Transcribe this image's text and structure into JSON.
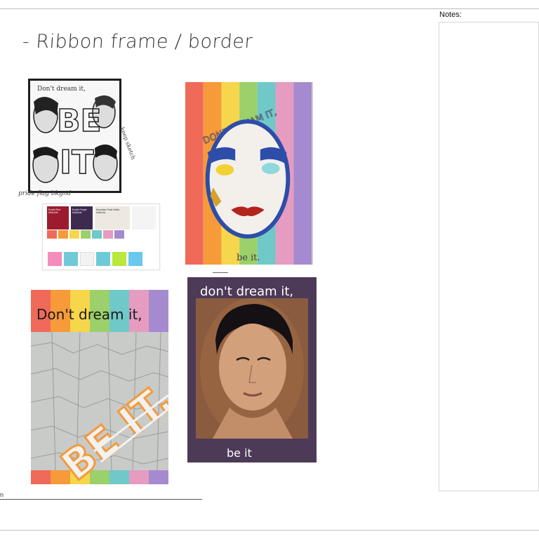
{
  "notes": {
    "label": "Notes:"
  },
  "heading": "- Ribbon frame / border",
  "sketch": {
    "line1": "Don't dream it,",
    "big1": "BE",
    "big2": "IT",
    "side_note": "keep sketch",
    "caption": "pride flag bkgnd"
  },
  "palette": {
    "swatches": [
      {
        "name": "Exotic Red",
        "code": "#9d1b2e",
        "color": "#9d1b2e"
      },
      {
        "name": "Exotic Purple",
        "code": "#3d2a4e",
        "color": "#3d2a4e"
      },
      {
        "name": "Mountain Peak White",
        "code": "#e8e4dc",
        "color": "#ede9e1"
      }
    ],
    "small_colors": [
      "#ef6a58",
      "#f69a3a",
      "#f6d64a",
      "#9bd06a",
      "#6fc9c8",
      "#e69bc0",
      "#a68ad0"
    ],
    "note_colors": [
      "#f48cbc",
      "#6fcad8",
      "#f2f2f2",
      "#7ee07a",
      "#b8e83a",
      "#6ac7ee"
    ]
  },
  "mask_poster": {
    "stripes": [
      "#ef6a58",
      "#f69a3a",
      "#f6d64a",
      "#9bd06a",
      "#6fc9c8",
      "#e69bc0",
      "#a68ad0"
    ],
    "top_text": "DON'T DREAM IT,",
    "bottom_text": "be it."
  },
  "cracked_poster": {
    "stripes": [
      "#ef6a58",
      "#f69a3a",
      "#f6d64a",
      "#9bd06a",
      "#6fc9c8",
      "#e69bc0",
      "#a68ad0"
    ],
    "top_text": "Don't dream it,",
    "big_text": "BE IT."
  },
  "portrait_poster": {
    "top_text": "don't dream it,",
    "bottom_text": "be it"
  },
  "stub_text": "n"
}
